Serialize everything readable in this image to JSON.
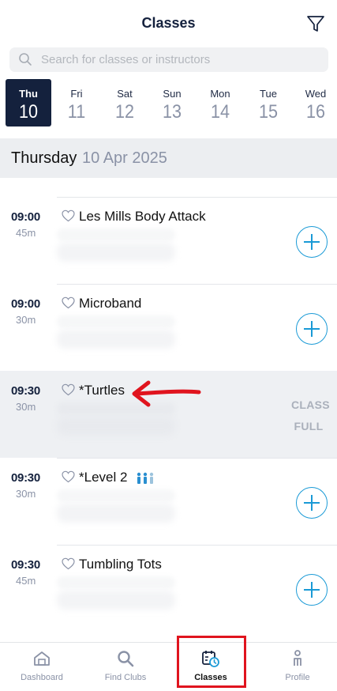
{
  "header": {
    "title": "Classes",
    "filter_icon": "funnel-icon"
  },
  "search": {
    "placeholder": "Search for classes or instructors",
    "value": ""
  },
  "days": [
    {
      "name": "Thu",
      "num": "10",
      "active": true
    },
    {
      "name": "Fri",
      "num": "11",
      "active": false
    },
    {
      "name": "Sat",
      "num": "12",
      "active": false
    },
    {
      "name": "Sun",
      "num": "13",
      "active": false
    },
    {
      "name": "Mon",
      "num": "14",
      "active": false
    },
    {
      "name": "Tue",
      "num": "15",
      "active": false
    },
    {
      "name": "Wed",
      "num": "16",
      "active": false
    }
  ],
  "section": {
    "weekday": "Thursday",
    "date": "10 Apr 2025"
  },
  "classes": [
    {
      "time": "09:00",
      "duration": "45m",
      "name": "Les Mills Body Attack",
      "status": "add"
    },
    {
      "time": "09:00",
      "duration": "30m",
      "name": "Microband",
      "status": "add"
    },
    {
      "time": "09:30",
      "duration": "30m",
      "name": "*Turtles",
      "status": "full",
      "full_line1": "CLASS",
      "full_line2": "FULL"
    },
    {
      "time": "09:30",
      "duration": "30m",
      "name": "*Level 2",
      "status": "add"
    },
    {
      "time": "09:30",
      "duration": "45m",
      "name": "Tumbling Tots",
      "status": "add"
    }
  ],
  "colors": {
    "navy": "#14213d",
    "accent": "#1a9ad6",
    "annotation": "#e0141e",
    "muted": "#8a92a6"
  },
  "nav": [
    {
      "label": "Dashboard",
      "icon": "home-icon",
      "active": false
    },
    {
      "label": "Find Clubs",
      "icon": "search-icon",
      "active": false
    },
    {
      "label": "Classes",
      "icon": "calendar-clock-icon",
      "active": true
    },
    {
      "label": "Profile",
      "icon": "person-icon",
      "active": false
    }
  ]
}
